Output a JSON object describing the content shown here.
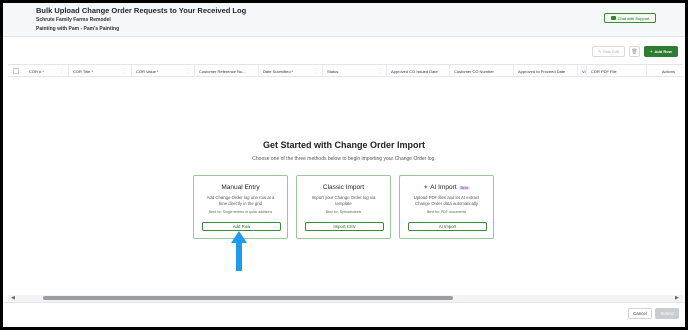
{
  "header": {
    "title": "Bulk Upload Change Order Requests to Your Received Log",
    "project": "Schrute Family Farms Remodel",
    "vendor": "Painting with Pam - Pam's Painting",
    "chat_label": "Chat with Support"
  },
  "toolbar": {
    "bulk_edit_label": "Bulk Edit",
    "add_row_label": "Add Row"
  },
  "grid": {
    "columns": [
      "COR # *",
      "COR Title *",
      "COR Value *",
      "Customer Reference Nu...",
      "Date Submitted *",
      "Status",
      "Approved CO Issued Date",
      "Customer CO Number",
      "Approved to Proceed Date",
      "Vi",
      "COR PDF File",
      "Actions"
    ]
  },
  "empty_state": {
    "title": "Get Started with Change Order Import",
    "description": "Choose one of the three methods below to begin importing your Change Order log."
  },
  "cards": [
    {
      "title": "Manual Entry",
      "description": "Add Change Order log one row at a time directly in the grid",
      "best_for": "Best for: Single entries or quick additions",
      "button": "Add Row"
    },
    {
      "title": "Classic Import",
      "description": "Import your Change Order log via template",
      "best_for": "Best for: Spreadsheets",
      "button": "Import CSV"
    },
    {
      "title": "AI Import",
      "badge": "Beta",
      "description": "Upload PDF files and let AI extract Change Order data automatically",
      "best_for": "Best for: PDF documents",
      "button": "AI Import"
    }
  ],
  "footer": {
    "cancel_label": "Cancel",
    "submit_label": "Submit"
  },
  "colors": {
    "accent_green": "#2e7d32",
    "card_border": "#9ac69a",
    "annotation_arrow": "#1e9be9",
    "ai_purple": "#a148d8"
  },
  "icons": [
    "chat-icon",
    "pencil-icon",
    "trash-icon",
    "plus-icon",
    "sparkle-icon",
    "kebab-menu-icon",
    "arrow-left-icon",
    "arrow-right-icon",
    "annotation-arrow-icon"
  ]
}
